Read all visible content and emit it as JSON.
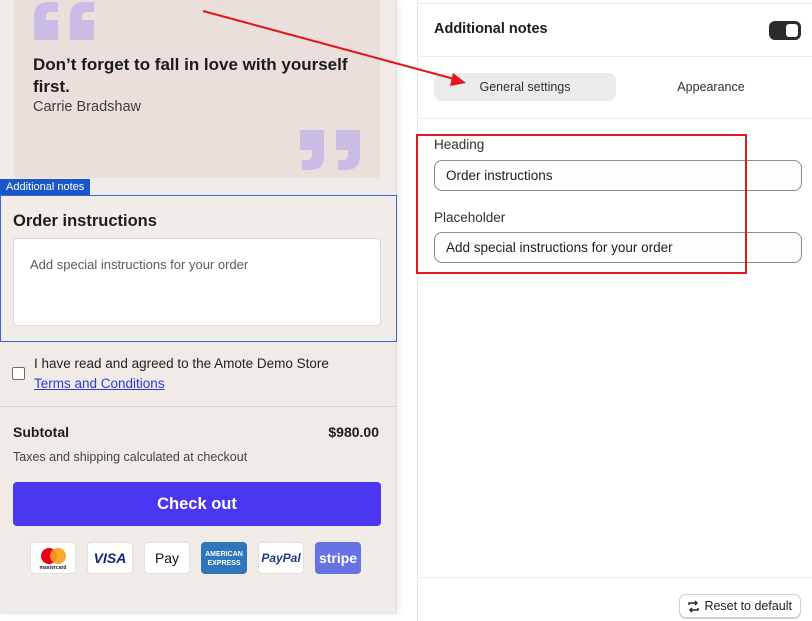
{
  "preview": {
    "quote": {
      "text": "Don’t forget to fall in love with yourself first.",
      "author": "Carrie Bradshaw",
      "mark_color": "#c9bde6"
    },
    "notes_tag": "Additional notes",
    "notes_heading": "Order instructions",
    "notes_placeholder": "Add special instructions for your order",
    "terms_text": "I have read and agreed to the Amote Demo Store",
    "terms_link": "Terms and Conditions",
    "subtotal_label": "Subtotal",
    "subtotal_value": "$980.00",
    "tax_note": "Taxes and shipping calculated at checkout",
    "checkout_label": "Check out",
    "checkout_color": "#4b36f2",
    "payment_methods": [
      "mastercard",
      "VISA",
      "Pay",
      "AMERICAN EXPRESS",
      "PayPal",
      "stripe"
    ]
  },
  "settings": {
    "title": "Additional notes",
    "toggle_on": true,
    "tabs": [
      {
        "label": "General settings",
        "active": true
      },
      {
        "label": "Appearance",
        "active": false
      }
    ],
    "fields": [
      {
        "label": "Heading",
        "value": "Order instructions"
      },
      {
        "label": "Placeholder",
        "value": "Add special instructions for your order"
      }
    ],
    "reset_label": "Reset to default"
  },
  "annotation_color": "#e2161b"
}
